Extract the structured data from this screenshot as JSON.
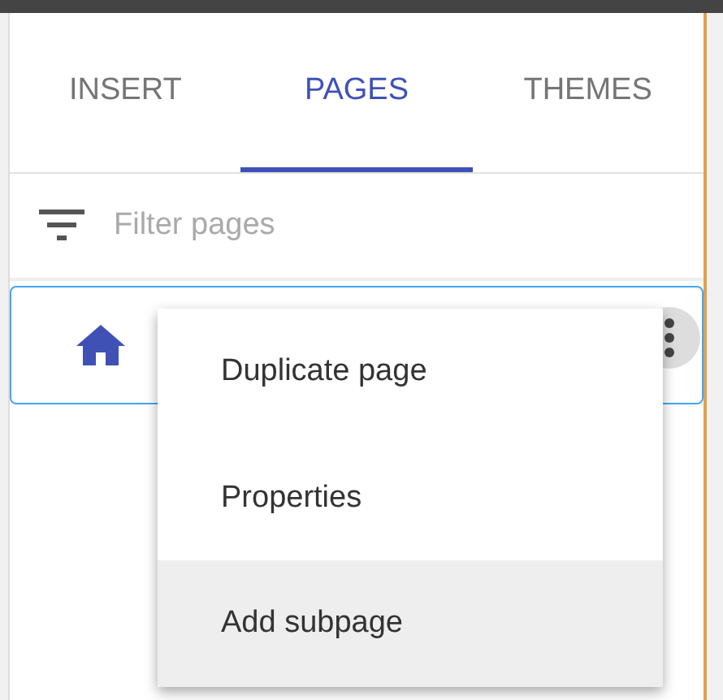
{
  "tabs": [
    {
      "label": "INSERT",
      "selected": false
    },
    {
      "label": "PAGES",
      "selected": true
    },
    {
      "label": "THEMES",
      "selected": false
    }
  ],
  "filter": {
    "placeholder": "Filter pages"
  },
  "pages": [
    {
      "home": true,
      "selected": true
    }
  ],
  "menu": [
    {
      "label": "Duplicate page",
      "highlighted": false
    },
    {
      "label": "Properties",
      "highlighted": false
    },
    {
      "label": "Add subpage",
      "highlighted": true
    }
  ]
}
